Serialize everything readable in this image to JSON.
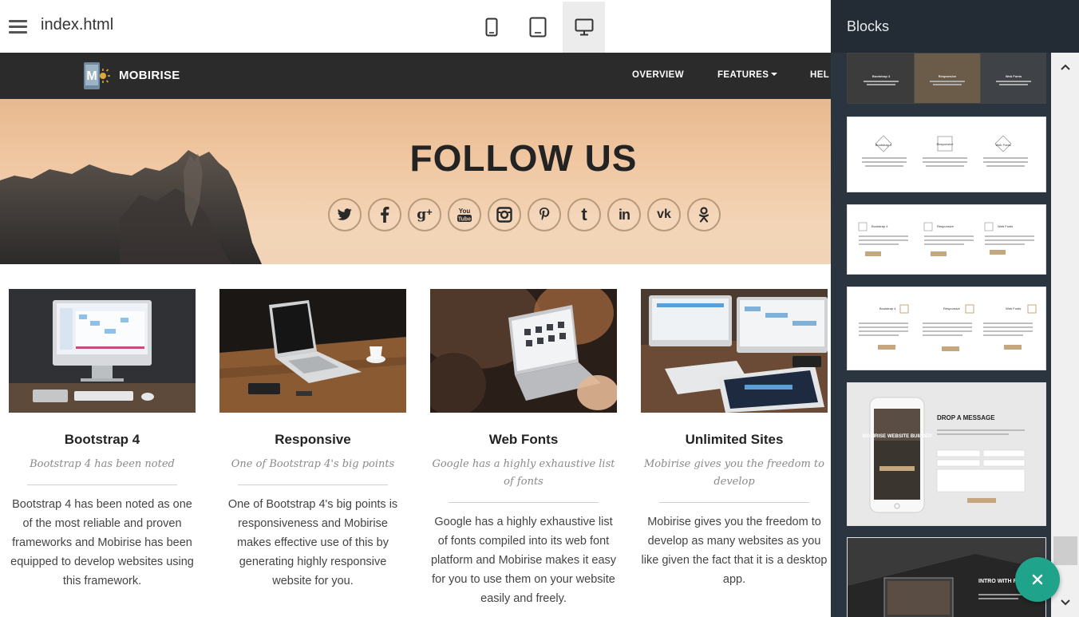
{
  "toolbar": {
    "menu_icon": "hamburger-icon",
    "filename": "index.html",
    "devices": [
      {
        "name": "mobile",
        "icon": "phone-icon",
        "active": false
      },
      {
        "name": "tablet",
        "icon": "tablet-icon",
        "active": false
      },
      {
        "name": "desktop",
        "icon": "desktop-icon",
        "active": true
      }
    ]
  },
  "site": {
    "brand": "MOBIRISE",
    "logo_letter": "M",
    "nav": [
      {
        "label": "OVERVIEW"
      },
      {
        "label": "FEATURES",
        "dropdown": true
      },
      {
        "label": "HEL"
      }
    ],
    "hero": {
      "title": "FOLLOW US",
      "socials": [
        "twitter-icon",
        "facebook-icon",
        "google-plus-icon",
        "youtube-icon",
        "instagram-icon",
        "pinterest-icon",
        "tumblr-icon",
        "linkedin-icon",
        "vk-icon",
        "odnoklassniki-icon"
      ]
    },
    "features": [
      {
        "title": "Bootstrap 4",
        "subtitle": "Bootstrap 4 has been noted",
        "body": "Bootstrap 4 has been noted as one of the most reliable and proven frameworks and Mobirise has been equipped to develop websites using this framework."
      },
      {
        "title": "Responsive",
        "subtitle": "One of Bootstrap 4's big points",
        "body": "One of Bootstrap 4's big points is responsiveness and Mobirise makes effective use of this by generating highly responsive website for you."
      },
      {
        "title": "Web Fonts",
        "subtitle": "Google has a highly exhaustive list of fonts",
        "body": "Google has a highly exhaustive list of fonts compiled into its web font platform and Mobirise makes it easy for you to use them on your website easily and freely."
      },
      {
        "title": "Unlimited Sites",
        "subtitle": "Mobirise gives you the freedom to develop",
        "body": "Mobirise gives you the freedom to develop as many websites as you like given the fact that it is a desktop app."
      }
    ]
  },
  "panel": {
    "title": "Blocks",
    "thumb_labels": {
      "t1": [
        "Bootstrap 4",
        "Responsive",
        "Web Fonts"
      ],
      "t5_title": "DROP A MESSAGE",
      "t5_phone": "MOBIRISE WEBSITE BUILDER",
      "t6_title": "INTRO WITH FORM"
    },
    "fab_icon": "close-icon"
  },
  "colors": {
    "accent": "#1fa38a",
    "panel_bg": "#2a3540",
    "nav_bg": "#2b2b2b",
    "social_border": "#b89a7a"
  }
}
